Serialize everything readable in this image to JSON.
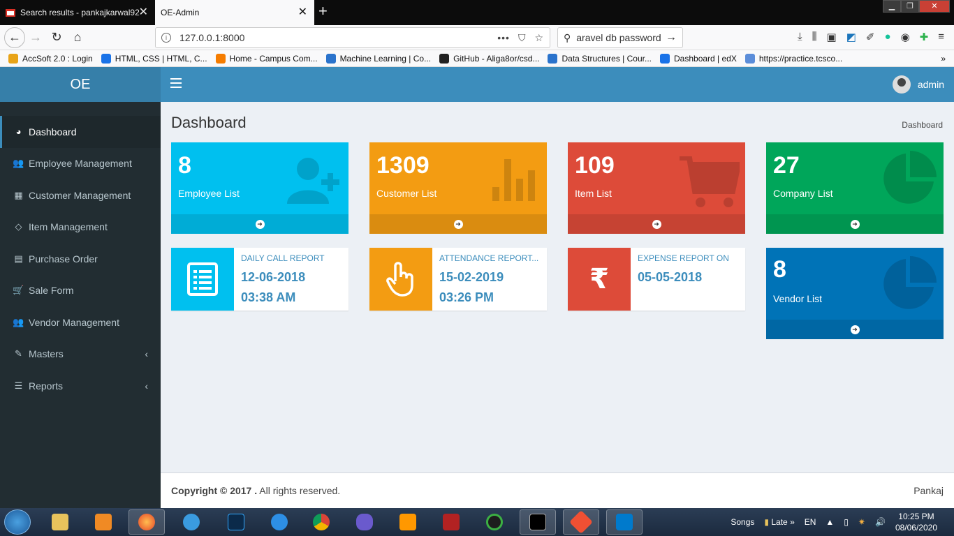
{
  "browser": {
    "tabs": [
      {
        "title": "Search results - pankajkarwal92"
      },
      {
        "title": "OE-Admin"
      }
    ],
    "url": "127.0.0.1:8000",
    "search_value": "aravel db password",
    "bookmarks": [
      {
        "label": "AccSoft 2.0 : Login",
        "color": "#e8a317"
      },
      {
        "label": "HTML, CSS | HTML, C...",
        "color": "#1a73e8"
      },
      {
        "label": "Home - Campus Com...",
        "color": "#f57c00"
      },
      {
        "label": "Machine Learning | Co...",
        "color": "#2a73cc"
      },
      {
        "label": "GitHub - Aliga8or/csd...",
        "color": "#222222"
      },
      {
        "label": "Data Structures | Cour...",
        "color": "#2a73cc"
      },
      {
        "label": "Dashboard | edX",
        "color": "#1a73e8"
      },
      {
        "label": "https://practice.tcsco...",
        "color": "#5b8dd9"
      }
    ]
  },
  "app": {
    "logo": "OE",
    "user": "admin",
    "sidebar": [
      {
        "label": "Dashboard",
        "icon": "dashboard-icon",
        "glyph": "◕",
        "active": true
      },
      {
        "label": "Employee Management",
        "icon": "users-icon",
        "glyph": "👥"
      },
      {
        "label": "Customer Management",
        "icon": "grid-icon",
        "glyph": "▦"
      },
      {
        "label": "Item Management",
        "icon": "diamond-icon",
        "glyph": "◇"
      },
      {
        "label": "Purchase Order",
        "icon": "list-alt-icon",
        "glyph": "▤"
      },
      {
        "label": "Sale Form",
        "icon": "cart-icon",
        "glyph": "🛒"
      },
      {
        "label": "Vendor Management",
        "icon": "users-icon",
        "glyph": "👥"
      },
      {
        "label": "Masters",
        "icon": "edit-icon",
        "glyph": "✎",
        "chevron": "‹"
      },
      {
        "label": "Reports",
        "icon": "list-icon",
        "glyph": "☰",
        "chevron": "‹"
      }
    ],
    "page_title": "Dashboard",
    "breadcrumb": "Dashboard",
    "small_boxes": [
      {
        "value": "8",
        "label": "Employee List",
        "color": "#00c0ef",
        "icon": "user-plus-icon"
      },
      {
        "value": "1309",
        "label": "Customer List",
        "color": "#f39c12",
        "icon": "bar-chart-icon"
      },
      {
        "value": "109",
        "label": "Item List",
        "color": "#dd4b39",
        "icon": "shopping-cart-icon"
      },
      {
        "value": "27",
        "label": "Company List",
        "color": "#00a65a",
        "icon": "pie-chart-icon"
      },
      {
        "value": "8",
        "label": "Vendor List",
        "color": "#0073b7",
        "icon": "pie-chart-icon"
      }
    ],
    "info_boxes": [
      {
        "text": "Daily Call Report",
        "date": "12-06-2018",
        "time": "03:38 AM",
        "color": "#00c0ef",
        "icon": "list-icon"
      },
      {
        "text": "Attendance Report...",
        "date": "15-02-2019",
        "time": "03:26 PM",
        "color": "#f39c12",
        "icon": "hand-pointer-icon"
      },
      {
        "text": "Expense Report On",
        "date": "05-05-2018",
        "time": "",
        "color": "#dd4b39",
        "icon": "rupee-icon"
      }
    ],
    "footer": {
      "copyright_bold": "Copyright © 2017 .",
      "copyright_rest": " All rights reserved.",
      "right": "Pankaj"
    }
  },
  "taskbar": {
    "tray_songs": "Songs",
    "tray_late": "Late",
    "tray_chev": "»",
    "tray_lang": "EN",
    "time": "10:25 PM",
    "date": "08/06/2020"
  }
}
